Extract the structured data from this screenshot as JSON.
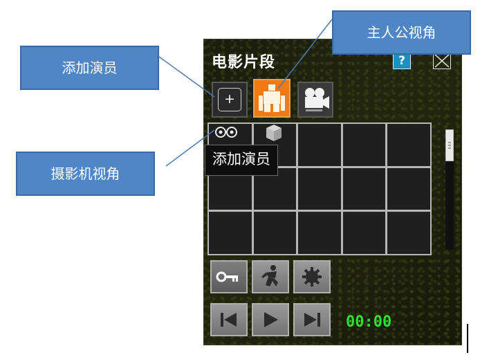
{
  "panel": {
    "title": "电影片段",
    "help_label": "?",
    "close_icon": "close-icon",
    "time": "00:00"
  },
  "tools": {
    "add_actor_label": "+",
    "add_actor_icon": "plus-icon",
    "hero_view_icon": "actor-figure-icon",
    "camera_view_icon": "movie-camera-icon"
  },
  "tooltip": {
    "text": "添加演员"
  },
  "controls": {
    "row1": [
      "key-icon",
      "dance-figure-icon",
      "gear-icon"
    ],
    "row2": [
      "skip-back-icon",
      "play-icon",
      "skip-forward-icon"
    ]
  },
  "callouts": {
    "add_actor": "添加演员",
    "hero_view": "主人公视角",
    "camera_view": "摄影机视角"
  },
  "colors": {
    "callout_fill": "#4f86c5",
    "hero_highlight": "#f07a14",
    "time_color": "#2fe02f",
    "panel_bg": "#1c1e0f"
  }
}
